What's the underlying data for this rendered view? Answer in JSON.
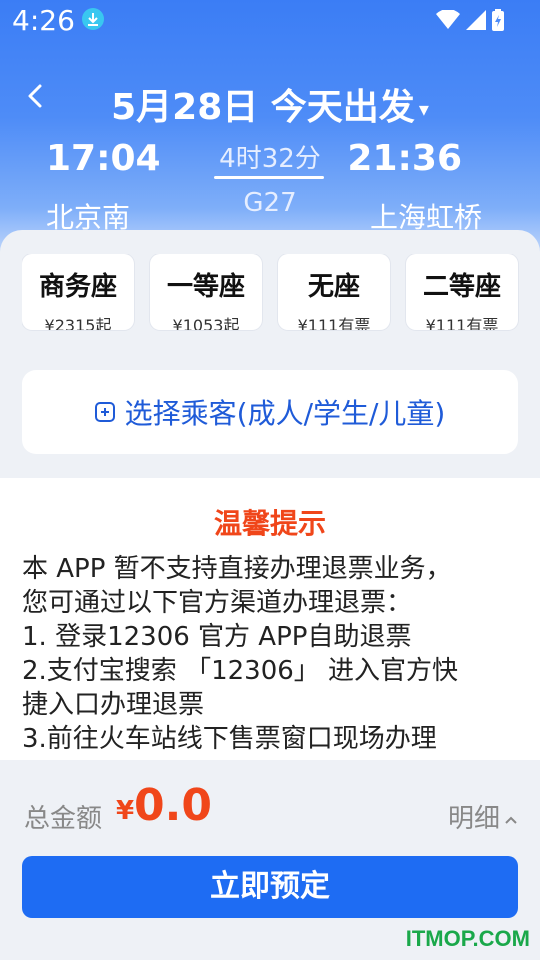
{
  "status_bar": {
    "time": "4:26"
  },
  "nav": {
    "title": "5月28日 今天出发",
    "caret": "▾",
    "back_icon": "chevron-left-icon"
  },
  "trip": {
    "depart_time": "17:04",
    "arrive_time": "21:36",
    "duration": "4时32分",
    "train_no": "G27",
    "depart_station": "北京南",
    "arrive_station": "上海虹桥"
  },
  "seats": [
    {
      "name": "商务座",
      "price": "¥2315起"
    },
    {
      "name": "一等座",
      "price": "¥1053起"
    },
    {
      "name": "无座",
      "price": "¥111有票"
    },
    {
      "name": "二等座",
      "price": "¥111有票"
    }
  ],
  "passenger": {
    "label": "选择乘客(成人/学生/儿童)"
  },
  "tips": {
    "title": "温馨提示",
    "lines": [
      "本 APP 暂不支持直接办理退票业务，",
      "您可通过以下官方渠道办理退票：",
      "1. 登录12306 官方 APP自助退票",
      "2.支付宝搜索 「12306」 进入官方快",
      "捷入口办理退票",
      "3.前往火车站线下售票窗口现场办理"
    ]
  },
  "footer": {
    "total_label": "总金额",
    "currency": "¥",
    "amount": "0.0",
    "detail_label": "明细",
    "book_label": "立即预定"
  },
  "watermark": "ITMOP.COM",
  "colors": {
    "primary": "#1e6cf3",
    "accent": "#f0461a"
  }
}
